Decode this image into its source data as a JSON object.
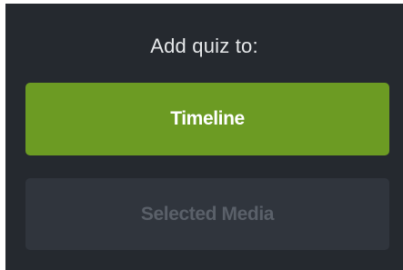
{
  "dialog": {
    "title": "Add quiz to:",
    "options": {
      "timeline_label": "Timeline",
      "selected_media_label": "Selected Media",
      "selected_media_state": "disabled"
    }
  },
  "colors": {
    "panel_background": "#25292f",
    "primary_button": "#6c9b23",
    "disabled_button": "#30353d",
    "disabled_text": "#5a6069",
    "title_text": "#e6e8ea"
  }
}
